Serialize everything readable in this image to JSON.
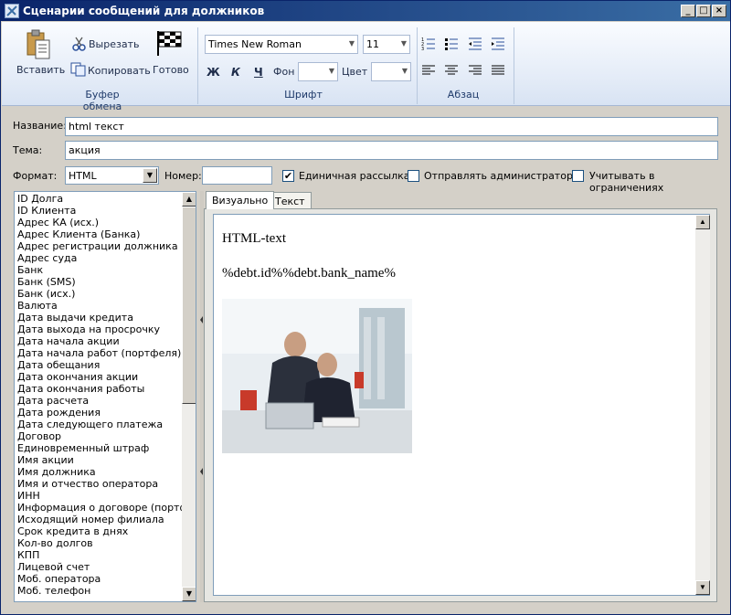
{
  "window": {
    "title": "Сценарии сообщений для должников"
  },
  "ribbon": {
    "clipboard": {
      "paste": "Вставить",
      "cut": "Вырезать",
      "copy": "Копировать",
      "done": "Готово",
      "group": "Буфер обмена"
    },
    "font": {
      "family": "Times New Roman",
      "size": "11",
      "bold": "Ж",
      "italic": "К",
      "underline": "Ч",
      "bg_label": "Фон",
      "color_label": "Цвет",
      "group": "Шрифт"
    },
    "paragraph": {
      "group": "Абзац"
    }
  },
  "form": {
    "name_label": "Название:",
    "name_value": "html текст",
    "topic_label": "Тема:",
    "topic_value": "акция",
    "format_label": "Формат:",
    "format_value": "HTML",
    "number_label": "Номер:",
    "number_value": "",
    "single_mailing": {
      "label": "Единичная рассылка",
      "checked": true
    },
    "send_admin": {
      "label": "Отправлять администратору",
      "checked": false
    },
    "count_limits": {
      "label": "Учитывать в ограничениях",
      "checked": false
    }
  },
  "variables": [
    "ID Долга",
    "ID Клиента",
    "Адрес КА (исх.)",
    "Адрес Клиента (Банка)",
    "Адрес регистрации должника",
    "Адрес суда",
    "Банк",
    "Банк (SMS)",
    "Банк (исх.)",
    "Валюта",
    "Дата выдачи кредита",
    "Дата выхода на просрочку",
    "Дата начала акции",
    "Дата начала работ (портфеля)",
    "Дата обещания",
    "Дата окончания акции",
    "Дата окончания работы",
    "Дата расчета",
    "Дата рождения",
    "Дата следующего платежа",
    "Договор",
    "Единовременный штраф",
    "Имя акции",
    "Имя должника",
    "Имя и отчество оператора",
    "ИНН",
    "Информация о договоре (портфеля",
    "Исходящий номер филиала",
    "Срок кредита в днях",
    "Кол-во долгов",
    "КПП",
    "Лицевой счет",
    "Моб. оператора",
    "Моб. телефон"
  ],
  "tabs": {
    "visual": "Визуально",
    "text": "Текст"
  },
  "editor": {
    "heading": "HTML-text",
    "template": "%debt.id%%debt.bank_name%"
  },
  "colors": {
    "titlebar": "#0a246a",
    "accent": "#3a6ea5"
  }
}
